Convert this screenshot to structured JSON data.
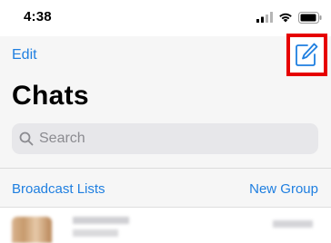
{
  "status_bar": {
    "time": "4:38",
    "icons": [
      "signal-icon",
      "wifi-icon",
      "battery-icon"
    ]
  },
  "nav": {
    "edit_label": "Edit",
    "compose_icon": "compose-icon",
    "highlight_color": "#e60000"
  },
  "header": {
    "title": "Chats"
  },
  "search": {
    "placeholder": "Search",
    "icon": "search-icon"
  },
  "lists": {
    "broadcast_label": "Broadcast Lists",
    "new_group_label": "New Group"
  },
  "colors": {
    "accent": "#1f7fe0",
    "background": "#f6f6f6",
    "search_bg": "#e7e7ea"
  }
}
